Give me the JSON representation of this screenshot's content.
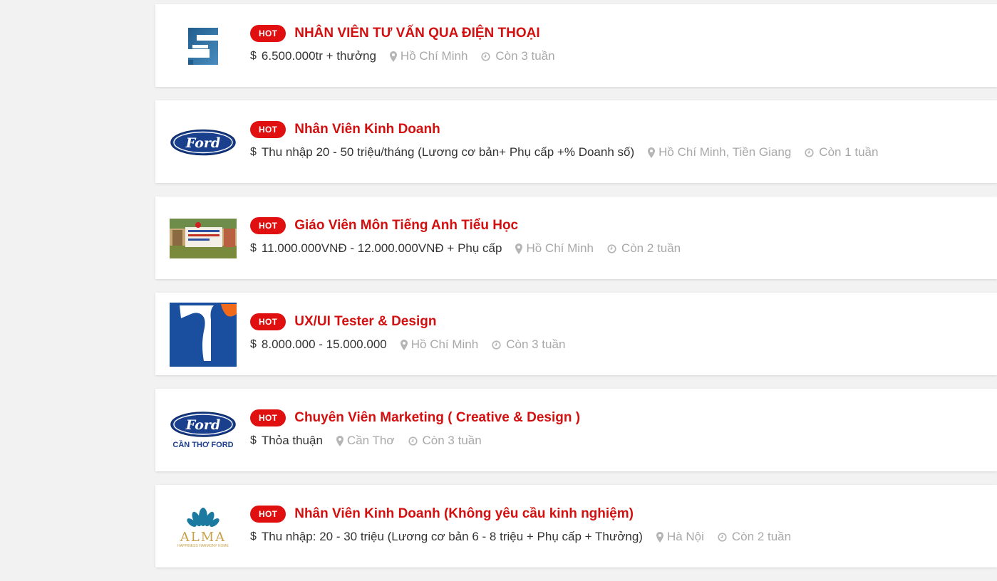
{
  "jobs": [
    {
      "hot": "HOT",
      "title": "NHÂN VIÊN TƯ VẤN QUA ĐIỆN THOẠI",
      "salary": "6.500.000tr + thưởng",
      "location": "Hồ Chí Minh",
      "remaining": "Còn 3 tuần",
      "logo": "blue-s-logo"
    },
    {
      "hot": "HOT",
      "title": "Nhân Viên Kinh Doanh",
      "salary": "Thu nhập 20 - 50 triệu/tháng (Lương cơ bản+ Phụ cấp +% Doanh số)",
      "location": "Hồ Chí Minh, Tiền Giang",
      "remaining": "Còn 1 tuần",
      "logo": "ford-logo",
      "logo_text": "Ford"
    },
    {
      "hot": "HOT",
      "title": "Giáo Viên Môn Tiếng Anh Tiểu Học",
      "salary": "11.000.000VNĐ - 12.000.000VNĐ + Phụ cấp",
      "location": "Hồ Chí Minh",
      "remaining": "Còn 2 tuần",
      "logo": "school-photo-logo"
    },
    {
      "hot": "HOT",
      "title": "UX/UI Tester & Design",
      "salary": "8.000.000 - 15.000.000",
      "location": "Hồ Chí Minh",
      "remaining": "Còn 3 tuần",
      "logo": "blue-t-logo"
    },
    {
      "hot": "HOT",
      "title": "Chuyên Viên Marketing ( Creative & Design )",
      "salary": "Thỏa thuận",
      "location": "Cần Thơ",
      "remaining": "Còn 3 tuần",
      "logo": "can-tho-ford-logo",
      "logo_text": "Ford",
      "logo_caption": "CẦN THƠ FORD"
    },
    {
      "hot": "HOT",
      "title": "Nhân Viên Kinh Doanh (Không yêu cầu kinh nghiệm)",
      "salary": "Thu nhập: 20 - 30 triệu (Lương cơ bản 6 - 8 triệu + Phụ cấp + Thưởng)",
      "location": "Hà Nội",
      "remaining": "Còn 2 tuần",
      "logo": "alma-logo",
      "logo_text": "ALMA",
      "logo_caption": "HAPPINESS HARMONY HOME"
    }
  ],
  "colors": {
    "hot_badge": "#e01010",
    "title": "#d31010",
    "meta": "#a8a8a8",
    "salary": "#333333",
    "background": "#f2f2f2"
  }
}
